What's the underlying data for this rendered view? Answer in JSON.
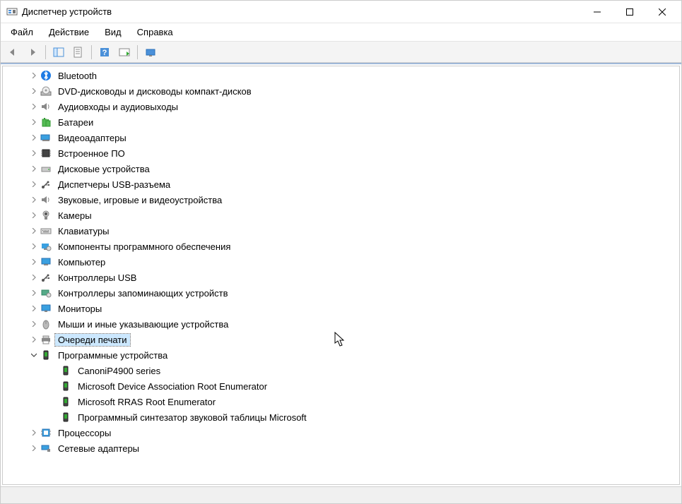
{
  "window": {
    "title": "Диспетчер устройств"
  },
  "menu": {
    "file": "Файл",
    "action": "Действие",
    "view": "Вид",
    "help": "Справка"
  },
  "tree": {
    "bluetooth": "Bluetooth",
    "dvd": "DVD-дисководы и дисководы компакт-дисков",
    "audio_io": "Аудиовходы и аудиовыходы",
    "batteries": "Батареи",
    "video_adapters": "Видеоадаптеры",
    "firmware": "Встроенное ПО",
    "disk_drives": "Дисковые устройства",
    "usb_controllers_label": "Диспетчеры USB-разъема",
    "sound_game_video": "Звуковые, игровые и видеоустройства",
    "cameras": "Камеры",
    "keyboards": "Клавиатуры",
    "software_components": "Компоненты программного обеспечения",
    "computer": "Компьютер",
    "usb_ctrl": "Контроллеры USB",
    "storage_ctrl": "Контроллеры запоминающих устройств",
    "monitors": "Мониторы",
    "mice": "Мыши и иные указывающие устройства",
    "print_queues": "Очереди печати",
    "software_devices": "Программные устройства",
    "sw_child_canon": "CanoniP4900 series",
    "sw_child_msdare": "Microsoft Device Association Root Enumerator",
    "sw_child_rras": "Microsoft RRAS Root Enumerator",
    "sw_child_synth": "Программный синтезатор звуковой таблицы Microsoft",
    "processors": "Процессоры",
    "network": "Сетевые адаптеры"
  }
}
